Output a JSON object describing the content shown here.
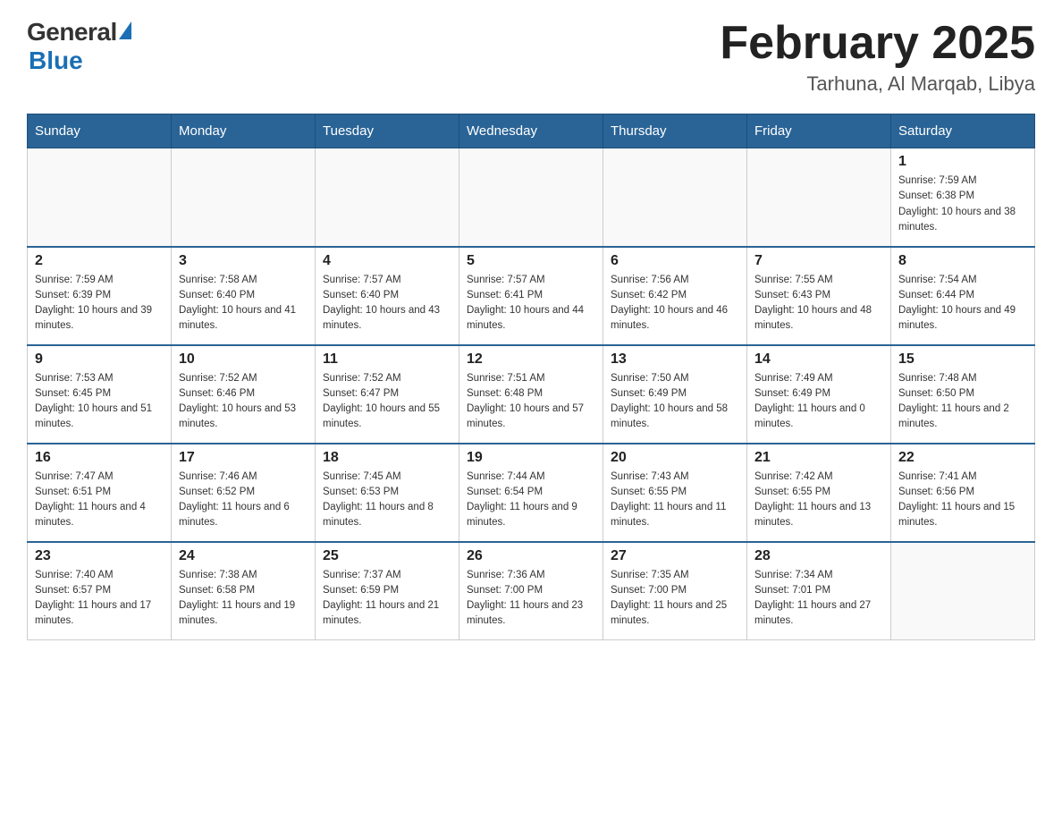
{
  "logo": {
    "general": "General",
    "blue": "Blue"
  },
  "title": "February 2025",
  "subtitle": "Tarhuna, Al Marqab, Libya",
  "weekdays": [
    "Sunday",
    "Monday",
    "Tuesday",
    "Wednesday",
    "Thursday",
    "Friday",
    "Saturday"
  ],
  "weeks": [
    [
      {
        "day": "",
        "sunrise": "",
        "sunset": "",
        "daylight": ""
      },
      {
        "day": "",
        "sunrise": "",
        "sunset": "",
        "daylight": ""
      },
      {
        "day": "",
        "sunrise": "",
        "sunset": "",
        "daylight": ""
      },
      {
        "day": "",
        "sunrise": "",
        "sunset": "",
        "daylight": ""
      },
      {
        "day": "",
        "sunrise": "",
        "sunset": "",
        "daylight": ""
      },
      {
        "day": "",
        "sunrise": "",
        "sunset": "",
        "daylight": ""
      },
      {
        "day": "1",
        "sunrise": "Sunrise: 7:59 AM",
        "sunset": "Sunset: 6:38 PM",
        "daylight": "Daylight: 10 hours and 38 minutes."
      }
    ],
    [
      {
        "day": "2",
        "sunrise": "Sunrise: 7:59 AM",
        "sunset": "Sunset: 6:39 PM",
        "daylight": "Daylight: 10 hours and 39 minutes."
      },
      {
        "day": "3",
        "sunrise": "Sunrise: 7:58 AM",
        "sunset": "Sunset: 6:40 PM",
        "daylight": "Daylight: 10 hours and 41 minutes."
      },
      {
        "day": "4",
        "sunrise": "Sunrise: 7:57 AM",
        "sunset": "Sunset: 6:40 PM",
        "daylight": "Daylight: 10 hours and 43 minutes."
      },
      {
        "day": "5",
        "sunrise": "Sunrise: 7:57 AM",
        "sunset": "Sunset: 6:41 PM",
        "daylight": "Daylight: 10 hours and 44 minutes."
      },
      {
        "day": "6",
        "sunrise": "Sunrise: 7:56 AM",
        "sunset": "Sunset: 6:42 PM",
        "daylight": "Daylight: 10 hours and 46 minutes."
      },
      {
        "day": "7",
        "sunrise": "Sunrise: 7:55 AM",
        "sunset": "Sunset: 6:43 PM",
        "daylight": "Daylight: 10 hours and 48 minutes."
      },
      {
        "day": "8",
        "sunrise": "Sunrise: 7:54 AM",
        "sunset": "Sunset: 6:44 PM",
        "daylight": "Daylight: 10 hours and 49 minutes."
      }
    ],
    [
      {
        "day": "9",
        "sunrise": "Sunrise: 7:53 AM",
        "sunset": "Sunset: 6:45 PM",
        "daylight": "Daylight: 10 hours and 51 minutes."
      },
      {
        "day": "10",
        "sunrise": "Sunrise: 7:52 AM",
        "sunset": "Sunset: 6:46 PM",
        "daylight": "Daylight: 10 hours and 53 minutes."
      },
      {
        "day": "11",
        "sunrise": "Sunrise: 7:52 AM",
        "sunset": "Sunset: 6:47 PM",
        "daylight": "Daylight: 10 hours and 55 minutes."
      },
      {
        "day": "12",
        "sunrise": "Sunrise: 7:51 AM",
        "sunset": "Sunset: 6:48 PM",
        "daylight": "Daylight: 10 hours and 57 minutes."
      },
      {
        "day": "13",
        "sunrise": "Sunrise: 7:50 AM",
        "sunset": "Sunset: 6:49 PM",
        "daylight": "Daylight: 10 hours and 58 minutes."
      },
      {
        "day": "14",
        "sunrise": "Sunrise: 7:49 AM",
        "sunset": "Sunset: 6:49 PM",
        "daylight": "Daylight: 11 hours and 0 minutes."
      },
      {
        "day": "15",
        "sunrise": "Sunrise: 7:48 AM",
        "sunset": "Sunset: 6:50 PM",
        "daylight": "Daylight: 11 hours and 2 minutes."
      }
    ],
    [
      {
        "day": "16",
        "sunrise": "Sunrise: 7:47 AM",
        "sunset": "Sunset: 6:51 PM",
        "daylight": "Daylight: 11 hours and 4 minutes."
      },
      {
        "day": "17",
        "sunrise": "Sunrise: 7:46 AM",
        "sunset": "Sunset: 6:52 PM",
        "daylight": "Daylight: 11 hours and 6 minutes."
      },
      {
        "day": "18",
        "sunrise": "Sunrise: 7:45 AM",
        "sunset": "Sunset: 6:53 PM",
        "daylight": "Daylight: 11 hours and 8 minutes."
      },
      {
        "day": "19",
        "sunrise": "Sunrise: 7:44 AM",
        "sunset": "Sunset: 6:54 PM",
        "daylight": "Daylight: 11 hours and 9 minutes."
      },
      {
        "day": "20",
        "sunrise": "Sunrise: 7:43 AM",
        "sunset": "Sunset: 6:55 PM",
        "daylight": "Daylight: 11 hours and 11 minutes."
      },
      {
        "day": "21",
        "sunrise": "Sunrise: 7:42 AM",
        "sunset": "Sunset: 6:55 PM",
        "daylight": "Daylight: 11 hours and 13 minutes."
      },
      {
        "day": "22",
        "sunrise": "Sunrise: 7:41 AM",
        "sunset": "Sunset: 6:56 PM",
        "daylight": "Daylight: 11 hours and 15 minutes."
      }
    ],
    [
      {
        "day": "23",
        "sunrise": "Sunrise: 7:40 AM",
        "sunset": "Sunset: 6:57 PM",
        "daylight": "Daylight: 11 hours and 17 minutes."
      },
      {
        "day": "24",
        "sunrise": "Sunrise: 7:38 AM",
        "sunset": "Sunset: 6:58 PM",
        "daylight": "Daylight: 11 hours and 19 minutes."
      },
      {
        "day": "25",
        "sunrise": "Sunrise: 7:37 AM",
        "sunset": "Sunset: 6:59 PM",
        "daylight": "Daylight: 11 hours and 21 minutes."
      },
      {
        "day": "26",
        "sunrise": "Sunrise: 7:36 AM",
        "sunset": "Sunset: 7:00 PM",
        "daylight": "Daylight: 11 hours and 23 minutes."
      },
      {
        "day": "27",
        "sunrise": "Sunrise: 7:35 AM",
        "sunset": "Sunset: 7:00 PM",
        "daylight": "Daylight: 11 hours and 25 minutes."
      },
      {
        "day": "28",
        "sunrise": "Sunrise: 7:34 AM",
        "sunset": "Sunset: 7:01 PM",
        "daylight": "Daylight: 11 hours and 27 minutes."
      },
      {
        "day": "",
        "sunrise": "",
        "sunset": "",
        "daylight": ""
      }
    ]
  ]
}
